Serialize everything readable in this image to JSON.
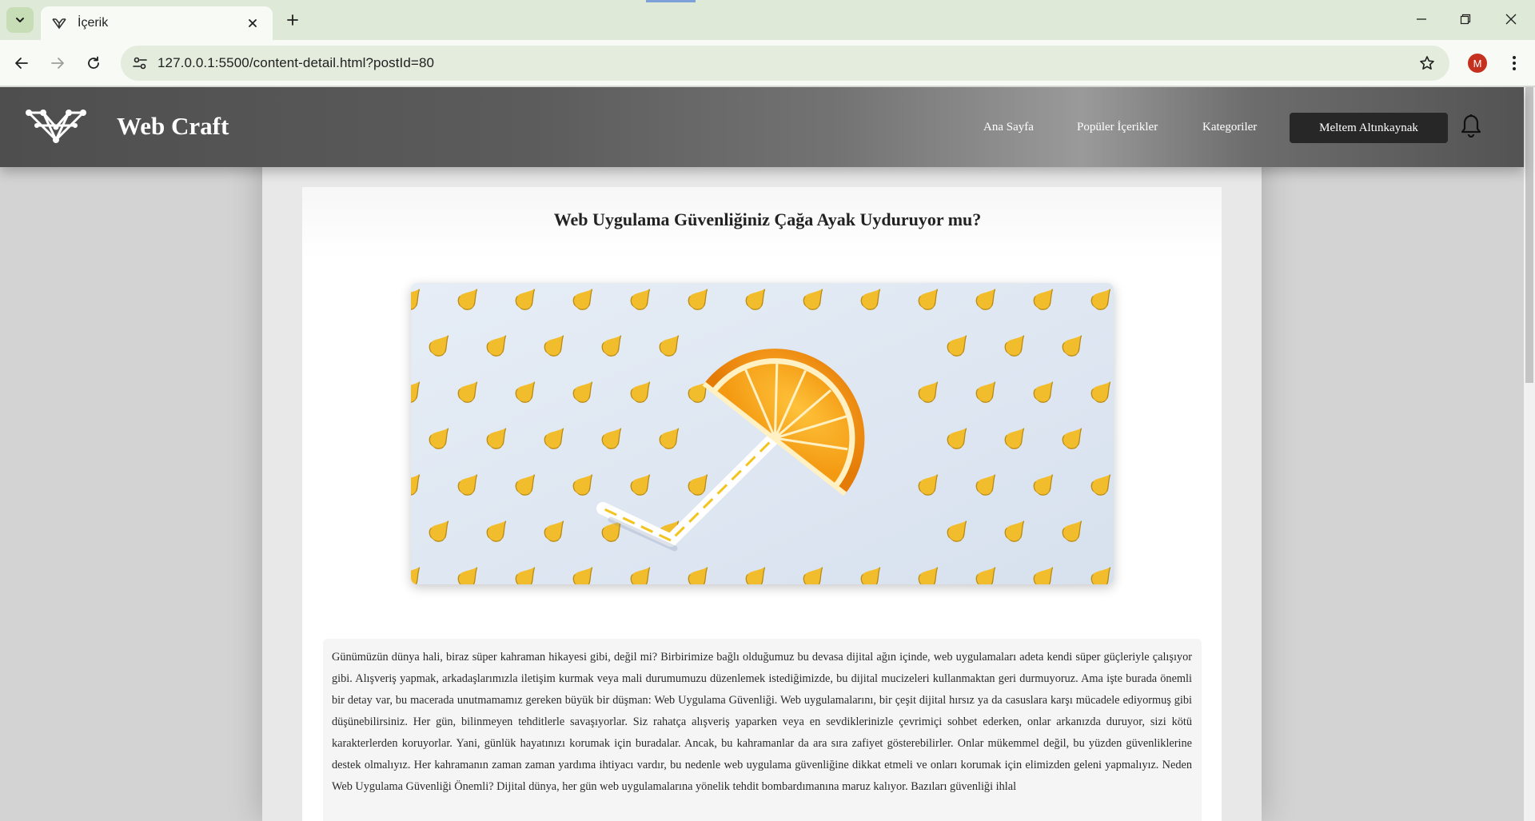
{
  "browser": {
    "tab_title": "İçerik",
    "url": "127.0.0.1:5500/content-detail.html?postId=80",
    "profile_initial": "M"
  },
  "site": {
    "brand": "Web Craft",
    "nav": [
      "Ana Sayfa",
      "Popüler İçerikler",
      "Kategoriler"
    ],
    "user_name": "Meltem Altınkaynak"
  },
  "post": {
    "title": "Web Uygulama Güvenliğiniz Çağa Ayak Uyduruyor mu?",
    "image_icon": "orange-slice-umbrella-image",
    "body": "Günümüzün dünya hali, biraz süper kahraman hikayesi gibi, değil mi? Birbirimize bağlı olduğumuz bu devasa dijital ağın içinde, web uygulamaları adeta kendi süper güçleriyle çalışıyor gibi. Alışveriş yapmak, arkadaşlarımızla iletişim kurmak veya mali durumumuzu düzenlemek istediğimizde, bu dijital mucizeleri kullanmaktan geri durmuyoruz. Ama işte burada önemli bir detay var, bu macerada unutmamamız gereken büyük bir düşman: Web Uygulama Güvenliği. Web uygulamalarını, bir çeşit dijital hırsız ya da casuslara karşı mücadele ediyormuş gibi düşünebilirsiniz. Her gün, bilinmeyen tehditlerle savaşıyorlar. Siz rahatça alışveriş yaparken veya en sevdiklerinizle çevrimiçi sohbet ederken, onlar arkanızda duruyor, sizi kötü karakterlerden koruyorlar. Yani, günlük hayatınızı korumak için buradalar. Ancak, bu kahramanlar da ara sıra zafiyet gösterebilirler. Onlar mükemmel değil, bu yüzden güvenliklerine destek olmalıyız. Her kahramanın zaman zaman yardıma ihtiyacı vardır, bu nedenle web uygulama güvenliğine dikkat etmeli ve onları korumak için elimizden geleni yapmalıyız. Neden Web Uygulama Güvenliği Önemli? Dijital dünya, her gün web uygulamalarına yönelik tehdit bombardımanına maruz kalıyor. Bazıları güvenliği ihlal"
  }
}
